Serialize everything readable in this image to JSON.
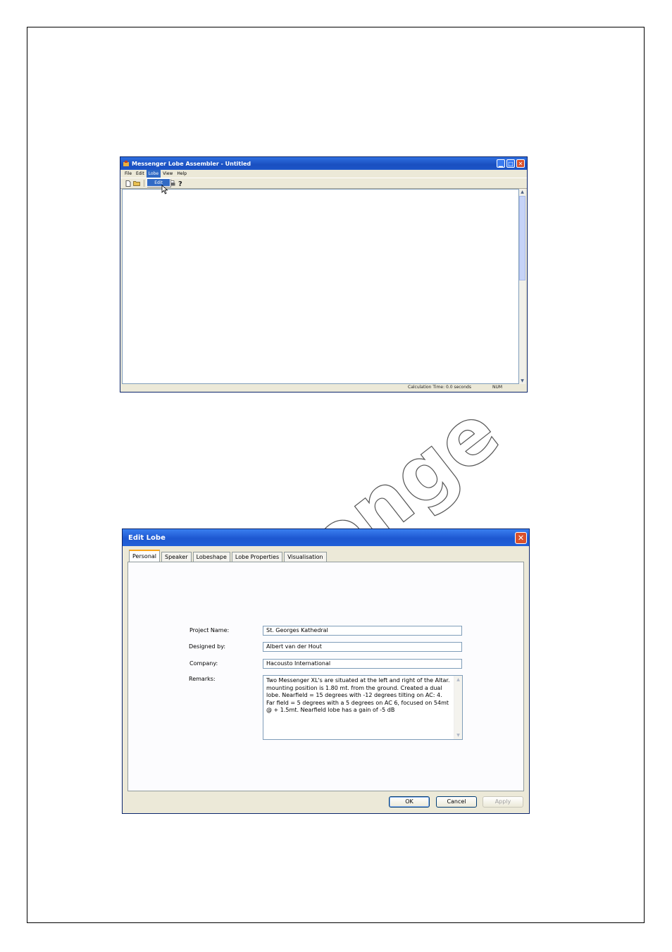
{
  "main_window": {
    "title": "Messenger Lobe Assembler - Untitled",
    "menu": [
      "File",
      "Edit",
      "Lobe",
      "View",
      "Help"
    ],
    "active_menu_index": 2,
    "dropdown_item": "Edit",
    "status": {
      "calc_time": "Calculation Time: 0.0 seconds",
      "num": "NUM"
    },
    "toolbar_icons": [
      "new-file-icon",
      "open-folder-icon",
      "save-icon",
      "grid-icon",
      "print-icon",
      "help-icon"
    ]
  },
  "watermark": {
    "text": "Messenger",
    "visible_text": "ssenge"
  },
  "dialog": {
    "title": "Edit Lobe",
    "tabs": [
      "Personal",
      "Speaker",
      "Lobeshape",
      "Lobe Properties",
      "Visualisation"
    ],
    "active_tab_index": 0,
    "labels": {
      "project_name": "Project Name:",
      "designed_by": "Designed by:",
      "company": "Company:",
      "remarks": "Remarks:"
    },
    "values": {
      "project_name": "St. Georges Kathedral",
      "designed_by": "Albert van der Hout",
      "company": "Hacousto International",
      "remarks": "Two Messenger XL's are situated at the left and right of the Altar. mounting position is 1.80 mt. from the ground. Created a dual lobe. Nearfield = 15 degrees with -12 degrees tilting on AC: 4. Far field = 5 degrees with a 5 degrees on AC 6, focused on 54mt @ + 1.5mt. Nearfield lobe has a gain of -5 dB"
    },
    "buttons": {
      "ok": "OK",
      "cancel": "Cancel",
      "apply": "Apply"
    }
  },
  "colors": {
    "xp_blue": "#1d57d0",
    "close_red": "#d9512c",
    "dialog_bg": "#ece9d8",
    "tab_highlight": "#f9a51b"
  }
}
